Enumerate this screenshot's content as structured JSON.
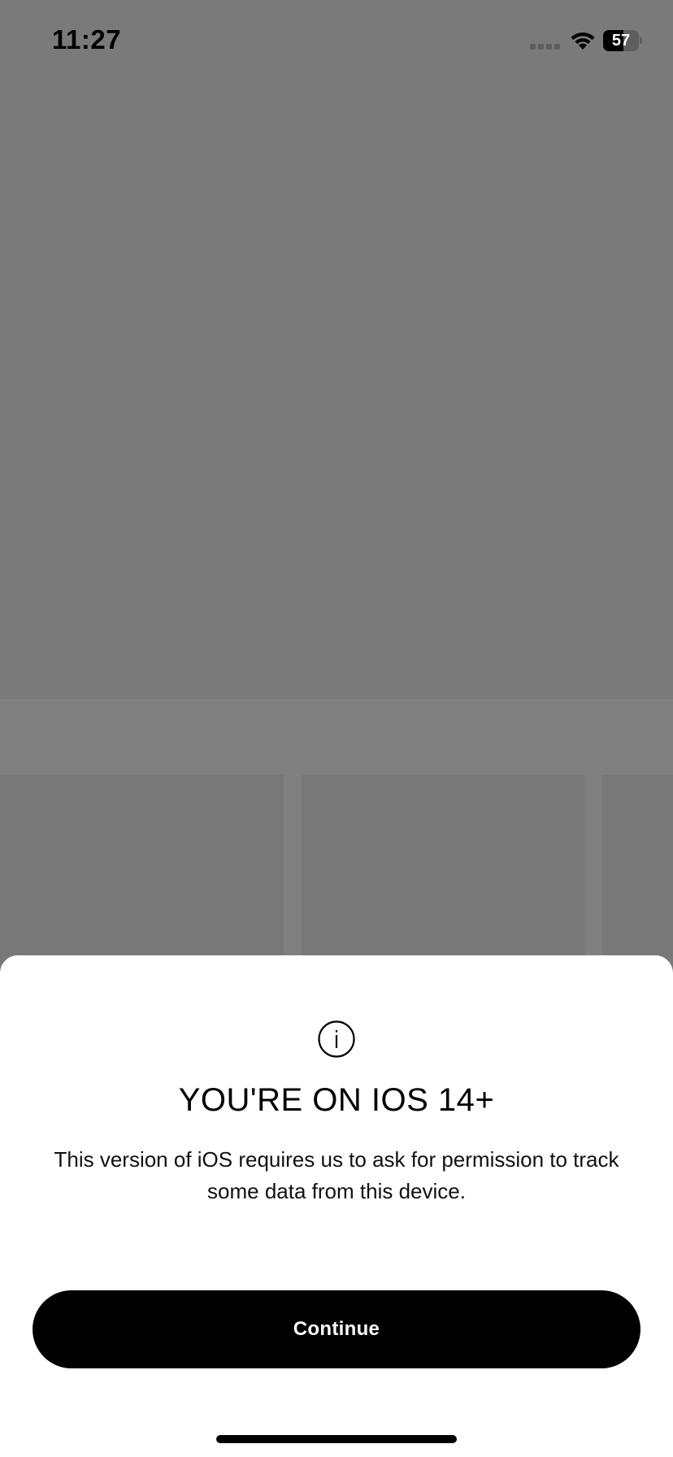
{
  "status_bar": {
    "time": "11:27",
    "battery_level": "57",
    "battery_fraction": 0.57,
    "signal_icon": "cellular-signal-icon",
    "wifi_icon": "wifi-icon"
  },
  "modal": {
    "icon": "info-icon",
    "title": "YOU'RE ON IOS 14+",
    "body": "This version of iOS requires us to ask for permission to track some data from this device.",
    "continue_label": "Continue"
  },
  "colors": {
    "backdrop": "#7a7a7a",
    "sheet": "#ffffff",
    "button": "#000000",
    "button_text": "#ffffff"
  }
}
